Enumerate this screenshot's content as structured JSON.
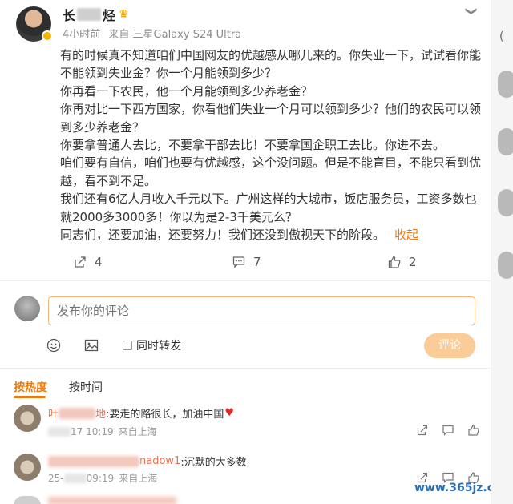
{
  "author": {
    "name_prefix": "长",
    "name_suffix": "烃",
    "time": "4小时前",
    "source": "来自 三星Galaxy S24 Ultra"
  },
  "post": {
    "paragraphs": [
      "有的时候真不知道咱们中国网友的优越感从哪儿来的。你失业一下，试试看你能不能领到失业金？你一个月能领到多少？",
      "你再看一下农民，他一个月能领到多少养老金？",
      "你再对比一下西方国家，你看他们失业一个月可以领到多少？他们的农民可以领到多少养老金？",
      "你要拿普通人去比，不要拿干部去比！不要拿国企职工去比。你进不去。",
      "咱们要有自信，咱们也要有优越感，这个没问题。但是不能盲目，不能只看到优越，看不到不足。",
      "我们还有6亿人月收入千元以下。广州这样的大城市，饭店服务员，工资多数也就2000多3000多！你以为是2-3千美元么？",
      "同志们，还要加油，还要努力！我们还没到傲视天下的阶段。"
    ],
    "collapse_label": "收起"
  },
  "actions": {
    "repost_count": "4",
    "comment_count": "7",
    "like_count": "2"
  },
  "comment_box": {
    "placeholder": "发布你的评论",
    "sync_label": "同时转发",
    "submit_label": "评论"
  },
  "sort": {
    "hot_label": "按热度",
    "time_label": "按时间"
  },
  "comments": [
    {
      "name_prefix": "叶",
      "name_suffix": "地",
      "text": ":要走的路很长，加油中国",
      "date_suffix": "17 10:19",
      "location": "来自上海"
    },
    {
      "name_suffix": "nadow1",
      "text": ":沉默的大多数",
      "date_prefix": "25-",
      "date_suffix": "09:19",
      "location": "来自上海"
    }
  ],
  "watermark": "www.365jz.com",
  "right_strip_text": "("
}
